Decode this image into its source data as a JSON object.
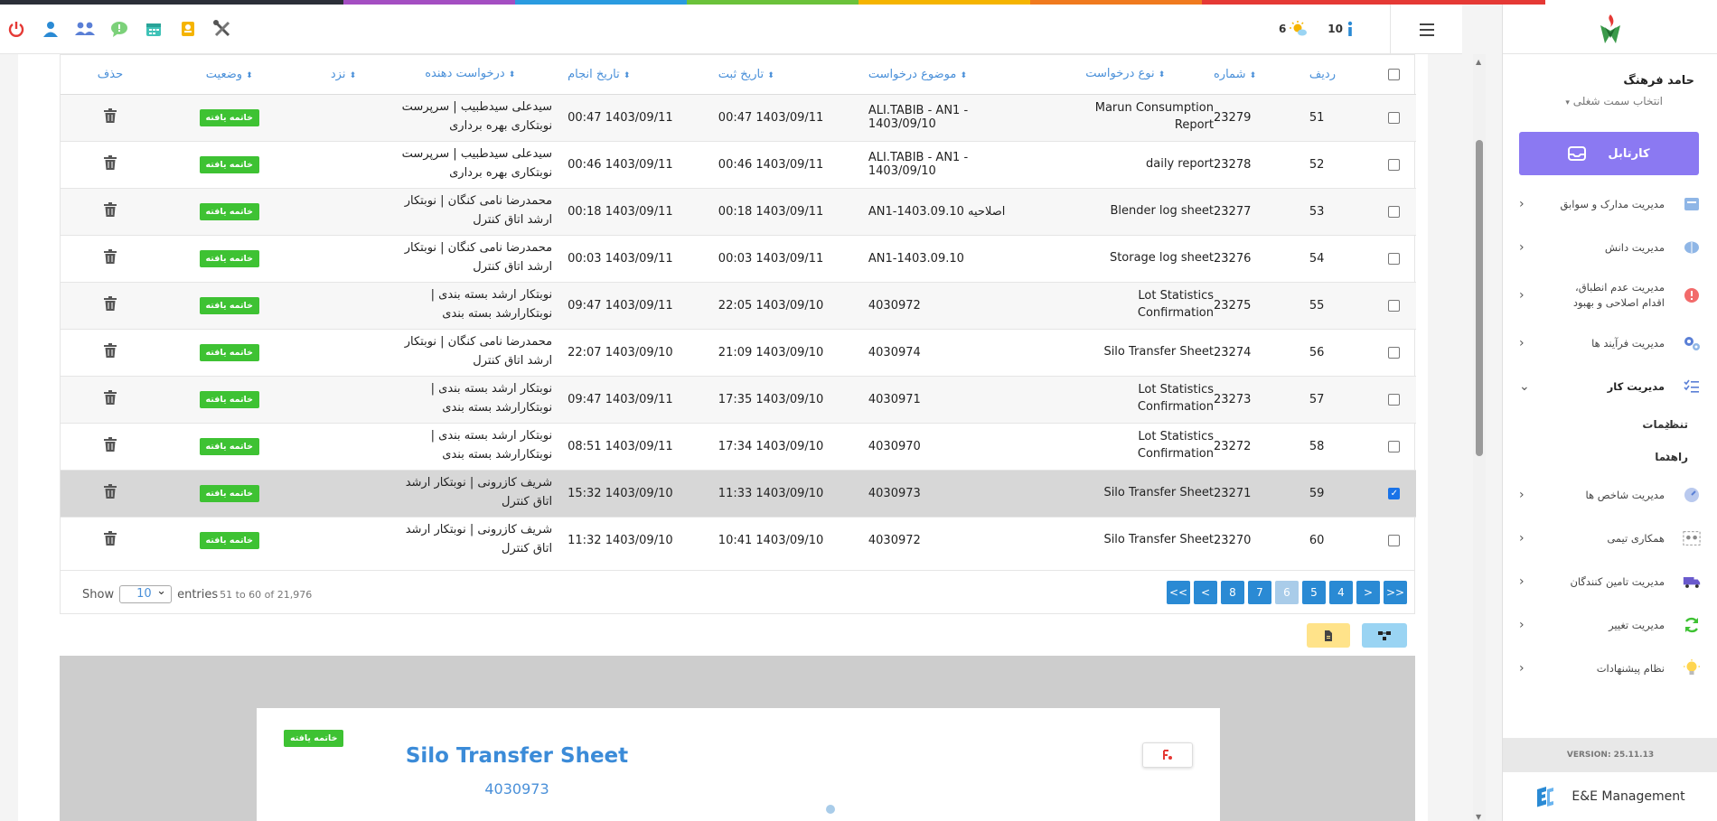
{
  "header": {
    "notif_count": "10",
    "weather_count": "6"
  },
  "sidebar": {
    "user_name": "حامد فرهنگ",
    "job_select": "انتخاب سمت شغلی",
    "kartabl": "کارتابل",
    "items": [
      {
        "label": "مدیریت مدارک و سوابق"
      },
      {
        "label": "مدیریت دانش"
      },
      {
        "label": "مدیریت عدم انطباق، اقدام اصلاحی و بهبود"
      },
      {
        "label": "مدیریت فرآیند ها"
      },
      {
        "label": "مدیریت کار"
      },
      {
        "label": "مدیریت شاخص ها"
      },
      {
        "label": "همکاری تیمی"
      },
      {
        "label": "مدیریت تامین کنندگان"
      },
      {
        "label": "مدیریت تغییر"
      },
      {
        "label": "نظام پیشنهادات"
      }
    ],
    "sub_items": [
      {
        "label": "تنظیمات"
      },
      {
        "label": "راهنما"
      }
    ],
    "version": "VERSION: 25.11.13",
    "brand": "E&E Management"
  },
  "table": {
    "headers": {
      "row": "ردیف",
      "number": "شماره",
      "type": "نوع درخواست",
      "subject": "موضوع درخواست",
      "registered": "تاریخ ثبت",
      "done": "تاریخ انجام",
      "requester": "درخواست دهنده",
      "at": "نزد",
      "status": "وضعیت",
      "delete": "حذف"
    },
    "rows": [
      {
        "row": "51",
        "number": "23279",
        "type": "Marun Consumption Report",
        "subject": "ALI.TABIB - AN1 - 1403/09/10",
        "registered": "00:47 1403/09/11",
        "done": "00:47 1403/09/11",
        "requester": "سیدعلی سیدطبیب | سرپرست نوبتکاری بهره برداری",
        "status": "خاتمه یافته",
        "checked": false
      },
      {
        "row": "52",
        "number": "23278",
        "type": "daily report",
        "subject": "ALI.TABIB - AN1 - 1403/09/10",
        "registered": "00:46 1403/09/11",
        "done": "00:46 1403/09/11",
        "requester": "سیدعلی سیدطبیب | سرپرست نوبتکاری بهره برداری",
        "status": "خاتمه یافته",
        "checked": false
      },
      {
        "row": "53",
        "number": "23277",
        "type": "Blender log sheet",
        "subject": "AN1-1403.09.10 اصلاحیه",
        "registered": "00:18 1403/09/11",
        "done": "00:18 1403/09/11",
        "requester": "محمدرضا نامی کنگان | نوبتکار ارشد اتاق کنترل",
        "status": "خاتمه یافته",
        "checked": false
      },
      {
        "row": "54",
        "number": "23276",
        "type": "Storage log sheet",
        "subject": "AN1-1403.09.10",
        "registered": "00:03 1403/09/11",
        "done": "00:03 1403/09/11",
        "requester": "محمدرضا نامی کنگان | نوبتکار ارشد اتاق کنترل",
        "status": "خاتمه یافته",
        "checked": false
      },
      {
        "row": "55",
        "number": "23275",
        "type": "Lot Statistics Confirmation",
        "subject": "4030972",
        "registered": "22:05 1403/09/10",
        "done": "09:47 1403/09/11",
        "requester": "نوبتکار ارشد بسته بندی | نوبتکارارشد بسته بندی",
        "status": "خاتمه یافته",
        "checked": false
      },
      {
        "row": "56",
        "number": "23274",
        "type": "Silo Transfer Sheet",
        "subject": "4030974",
        "registered": "21:09 1403/09/10",
        "done": "22:07 1403/09/10",
        "requester": "محمدرضا نامی کنگان | نوبتکار ارشد اتاق کنترل",
        "status": "خاتمه یافته",
        "checked": false
      },
      {
        "row": "57",
        "number": "23273",
        "type": "Lot Statistics Confirmation",
        "subject": "4030971",
        "registered": "17:35 1403/09/10",
        "done": "09:47 1403/09/11",
        "requester": "نوبتکار ارشد بسته بندی | نوبتکارارشد بسته بندی",
        "status": "خاتمه یافته",
        "checked": false
      },
      {
        "row": "58",
        "number": "23272",
        "type": "Lot Statistics Confirmation",
        "subject": "4030970",
        "registered": "17:34 1403/09/10",
        "done": "08:51 1403/09/11",
        "requester": "نوبتکار ارشد بسته بندی | نوبتکارارشد بسته بندی",
        "status": "خاتمه یافته",
        "checked": false
      },
      {
        "row": "59",
        "number": "23271",
        "type": "Silo Transfer Sheet",
        "subject": "4030973",
        "registered": "11:33 1403/09/10",
        "done": "15:32 1403/09/10",
        "requester": "شریف کازرونی | نوبتکار ارشد اتاق کنترل",
        "status": "خاتمه یافته",
        "checked": true
      },
      {
        "row": "60",
        "number": "23270",
        "type": "Silo Transfer Sheet",
        "subject": "4030972",
        "registered": "10:41 1403/09/10",
        "done": "11:32 1403/09/10",
        "requester": "شریف کازرونی | نوبتکار ارشد اتاق کنترل",
        "status": "خاتمه یافته",
        "checked": false
      }
    ]
  },
  "footer": {
    "show_label": "Show",
    "page_size": "10",
    "entries_label": "entries",
    "info": "51 to 60 of 21,976",
    "pages": [
      "<<",
      "<",
      "8",
      "7",
      "6",
      "5",
      "4",
      ">",
      ">>"
    ],
    "active_page": "6"
  },
  "preview": {
    "status": "خاتمه یافته",
    "title": "Silo Transfer Sheet",
    "number": "4030973"
  },
  "colors": {
    "accent": "#2a8ad4",
    "kartabl": "#8b79f2",
    "status_green": "#3ec233",
    "selected_row": "#d7d7d7"
  }
}
